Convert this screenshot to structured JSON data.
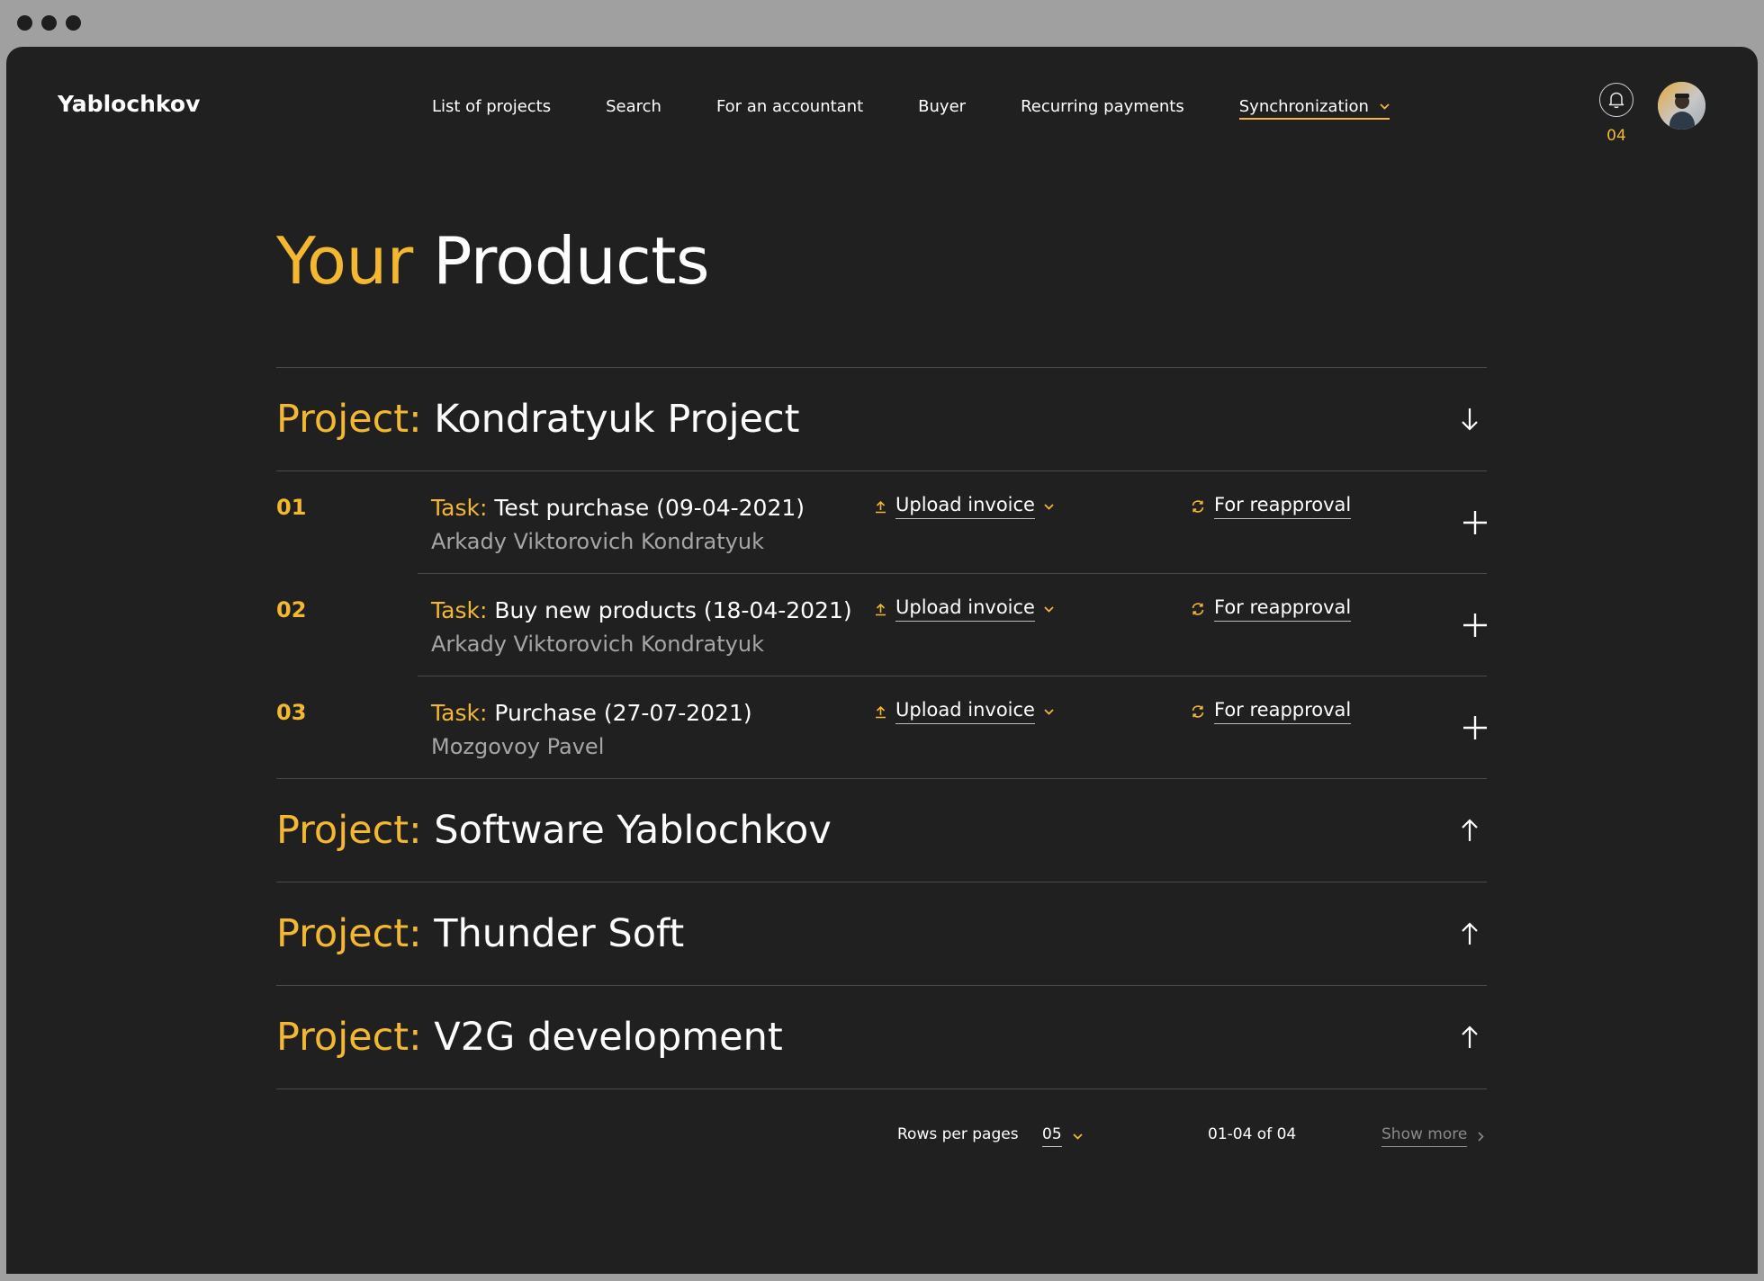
{
  "app": {
    "logo": "Yablochkov"
  },
  "nav": {
    "items": [
      "List of projects",
      "Search",
      "For an accountant",
      "Buyer",
      "Recurring payments"
    ],
    "active": "Synchronization"
  },
  "header": {
    "notification_count": "04"
  },
  "page": {
    "title_accent": "Your",
    "title_main": "Products"
  },
  "labels": {
    "project": "Project:",
    "task": "Task:"
  },
  "projects": [
    {
      "name": "Kondratyuk Project",
      "expanded": true,
      "tasks": [
        {
          "num": "01",
          "name": "Test purchase (09-04-2021)",
          "person": "Arkady Viktorovich Kondratyuk",
          "upload": "Upload invoice",
          "status": "For reapproval"
        },
        {
          "num": "02",
          "name": "Buy new products (18-04-2021)",
          "person": "Arkady Viktorovich Kondratyuk",
          "upload": "Upload invoice",
          "status": "For reapproval"
        },
        {
          "num": "03",
          "name": "Purchase (27-07-2021)",
          "person": "Mozgovoy Pavel",
          "upload": "Upload invoice",
          "status": "For reapproval"
        }
      ]
    },
    {
      "name": "Software Yablochkov",
      "expanded": false,
      "tasks": []
    },
    {
      "name": "Thunder Soft",
      "expanded": false,
      "tasks": []
    },
    {
      "name": "V2G development",
      "expanded": false,
      "tasks": []
    }
  ],
  "pagination": {
    "rows_label": "Rows per pages",
    "rows_value": "05",
    "range": "01-04 of 04",
    "show_more": "Show more"
  },
  "colors": {
    "accent": "#f3b82f",
    "background": "#202020",
    "muted": "#a6a6a6",
    "divider": "#4a4a4a"
  },
  "icons": {
    "notification": "bell-icon",
    "expand": "arrow-down-icon",
    "collapse": "arrow-up-icon",
    "upload": "upload-icon",
    "status": "refresh-icon",
    "add": "plus-icon",
    "dropdown": "chevron-down-icon",
    "next": "chevron-right-icon"
  }
}
